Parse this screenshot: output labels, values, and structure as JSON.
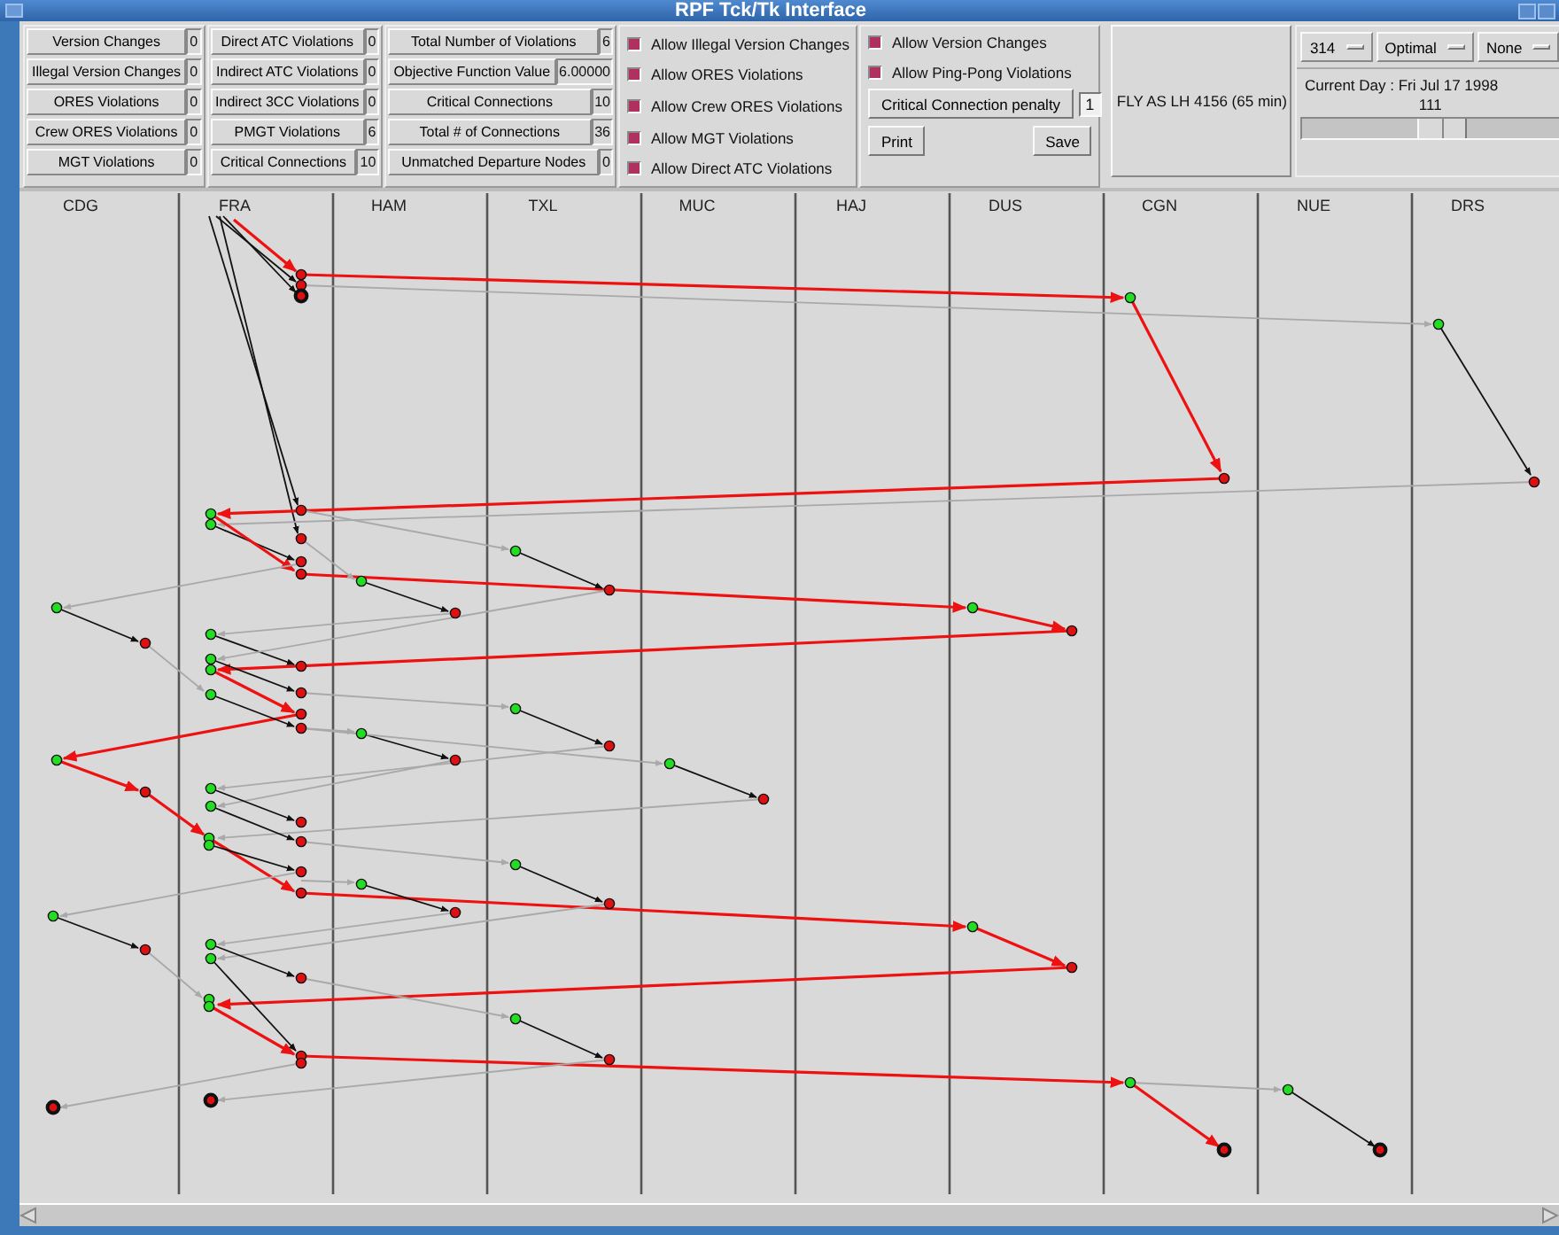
{
  "window": {
    "title": "RPF Tck/Tk Interface"
  },
  "counter_groups": [
    [
      {
        "label": "Version Changes",
        "value": "0"
      },
      {
        "label": "Illegal Version Changes",
        "value": "0"
      },
      {
        "label": "ORES Violations",
        "value": "0"
      },
      {
        "label": "Crew ORES Violations",
        "value": "0"
      },
      {
        "label": "MGT Violations",
        "value": "0"
      }
    ],
    [
      {
        "label": "Direct ATC Violations",
        "value": "0"
      },
      {
        "label": "Indirect ATC Violations",
        "value": "0"
      },
      {
        "label": "Indirect 3CC Violations",
        "value": "0"
      },
      {
        "label": "PMGT Violations",
        "value": "6"
      },
      {
        "label": "Critical Connections",
        "value": "10"
      }
    ],
    [
      {
        "label": "Total Number of Violations",
        "value": "6"
      },
      {
        "label": "Objective Function Value",
        "value": "6.00000"
      },
      {
        "label": "Critical Connections",
        "value": "10"
      },
      {
        "label": "Total # of Connections",
        "value": "36"
      },
      {
        "label": "Unmatched Departure Nodes",
        "value": "0"
      }
    ]
  ],
  "options": [
    {
      "label": "Allow Illegal Version Changes",
      "checked": true
    },
    {
      "label": "Allow ORES Violations",
      "checked": true
    },
    {
      "label": "Allow Crew ORES Violations",
      "checked": true
    },
    {
      "label": "Allow MGT Violations",
      "checked": true
    },
    {
      "label": "Allow Direct ATC Violations",
      "checked": true
    }
  ],
  "options_2": [
    {
      "label": "Allow Version Changes",
      "checked": true
    },
    {
      "label": "Allow Ping-Pong Violations",
      "checked": true
    }
  ],
  "penalty": {
    "label": "Critical Connection penalty",
    "value": "1"
  },
  "buttons": [
    "Print",
    "Save"
  ],
  "info": "FLY AS LH 4156 (65 min)",
  "dropdowns": [
    "314",
    "Optimal",
    "None"
  ],
  "current_day": "Current Day : Fri Jul 17 1998",
  "slider": {
    "reading": "111",
    "level": 0.55
  },
  "columns": [
    "CDG",
    "FRA",
    "HAM",
    "TXL",
    "MUC",
    "HAJ",
    "DUS",
    "CGN",
    "NUE",
    "DRS"
  ]
}
